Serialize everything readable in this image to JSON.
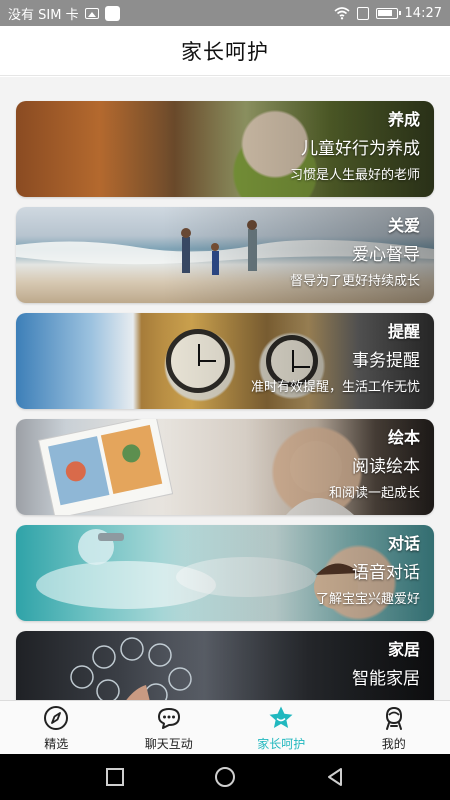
{
  "status_bar": {
    "carrier": "没有 SIM 卡",
    "time": "14:27",
    "icons": [
      "image-icon",
      "square-icon",
      "wifi-icon",
      "eye-icon",
      "battery-icon"
    ]
  },
  "header": {
    "title": "家长呵护"
  },
  "cards": [
    {
      "tag": "养成",
      "title": "儿童好行为养成",
      "subtitle": "习惯是人生最好的老师"
    },
    {
      "tag": "关爱",
      "title": "爱心督导",
      "subtitle": "督导为了更好持续成长"
    },
    {
      "tag": "提醒",
      "title": "事务提醒",
      "subtitle": "准时有效提醒，生活工作无忧"
    },
    {
      "tag": "绘本",
      "title": "阅读绘本",
      "subtitle": "和阅读一起成长"
    },
    {
      "tag": "对话",
      "title": "语音对话",
      "subtitle": "了解宝宝兴趣爱好"
    },
    {
      "tag": "家居",
      "title": "智能家居",
      "subtitle": ""
    }
  ],
  "tabs": [
    {
      "label": "精选",
      "icon": "compass-icon",
      "active": false
    },
    {
      "label": "聊天互动",
      "icon": "chat-icon",
      "active": false
    },
    {
      "label": "家长呵护",
      "icon": "star-icon",
      "active": true
    },
    {
      "label": "我的",
      "icon": "profile-icon",
      "active": false
    }
  ],
  "colors": {
    "accent": "#21b8bf",
    "status_bar": "#8e8e8e",
    "nav_bar": "#000000"
  }
}
